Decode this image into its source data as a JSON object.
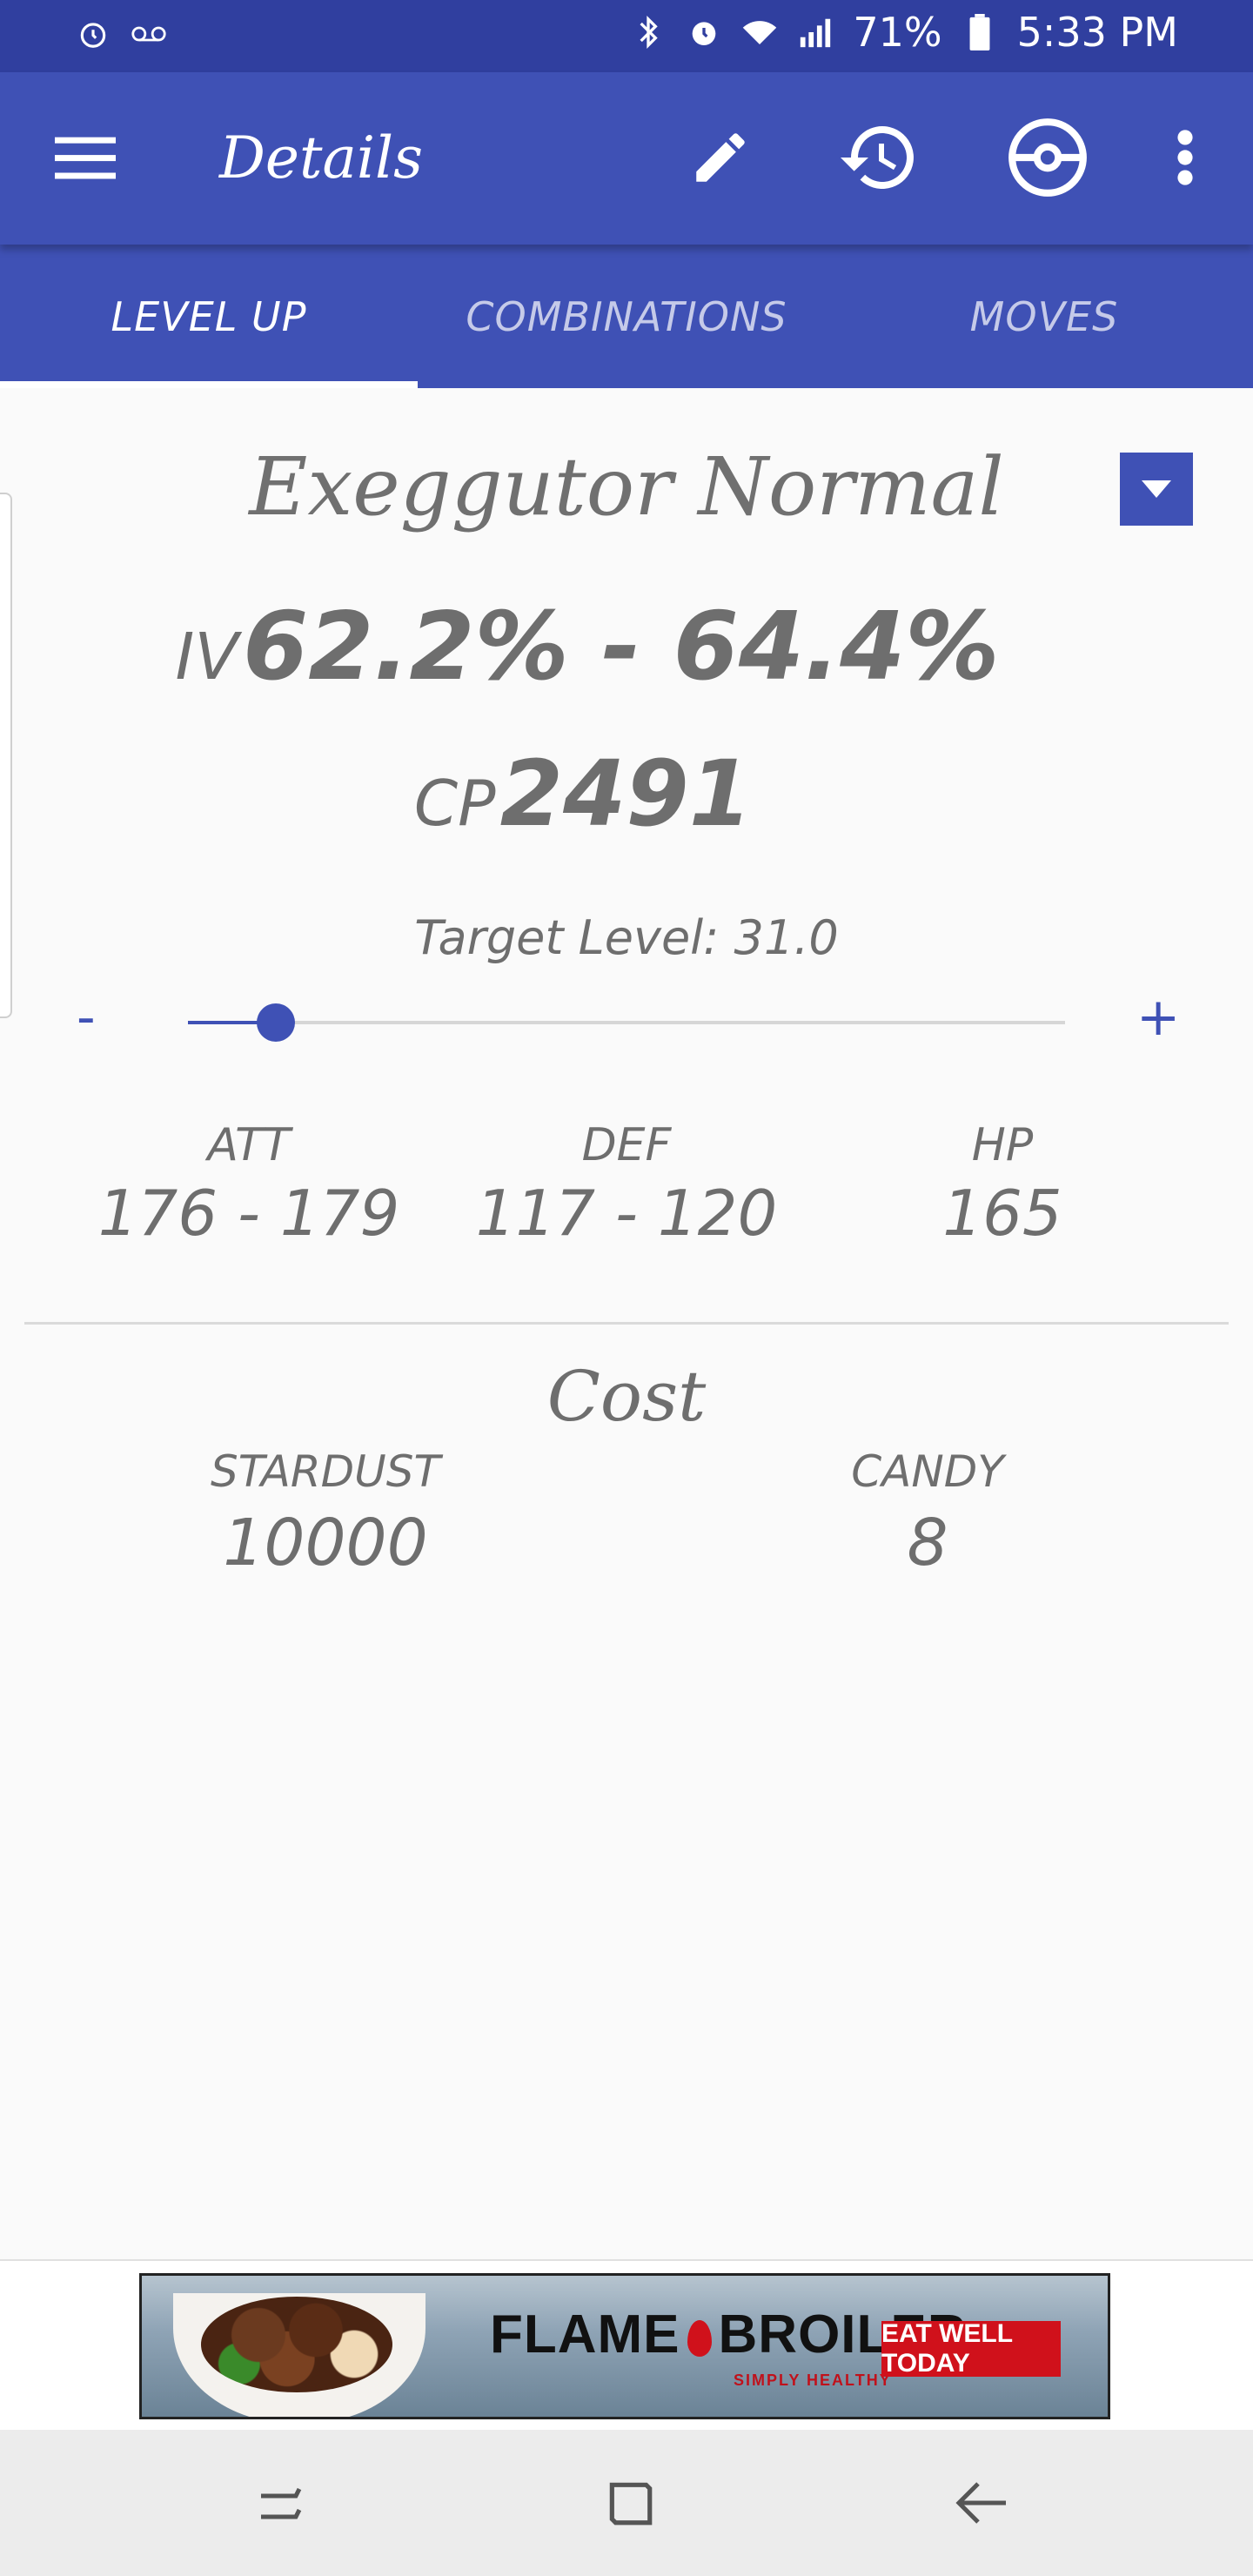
{
  "statusbar": {
    "battery": "71%",
    "time": "5:33 PM"
  },
  "appbar": {
    "title": "Details"
  },
  "tabs": [
    {
      "label": "LEVEL UP",
      "active": true
    },
    {
      "label": "COMBINATIONS",
      "active": false
    },
    {
      "label": "MOVES",
      "active": false
    }
  ],
  "pokemon": {
    "name": "Exeggutor Normal",
    "iv_label": "IV",
    "iv_value": "62.2% - 64.4%",
    "cp_label": "CP",
    "cp_value": "2491"
  },
  "level": {
    "target_label": "Target Level: 31.0",
    "minus": "-",
    "plus": "+",
    "slider_fraction": 0.1
  },
  "stats": {
    "att_label": "ATT",
    "att_value": "176 - 179",
    "def_label": "DEF",
    "def_value": "117 - 120",
    "hp_label": "HP",
    "hp_value": "165"
  },
  "cost": {
    "title": "Cost",
    "stardust_label": "STARDUST",
    "stardust_value": "10000",
    "candy_label": "CANDY",
    "candy_value": "8"
  },
  "ad": {
    "brand_left": "FLAME",
    "brand_right": "BROILER",
    "tagline": "SIMPLY HEALTHY",
    "cta": "EAT WELL TODAY"
  },
  "colors": {
    "primary": "#3f51b5",
    "primary_dark": "#303f9f",
    "text": "#6e6e6e"
  }
}
